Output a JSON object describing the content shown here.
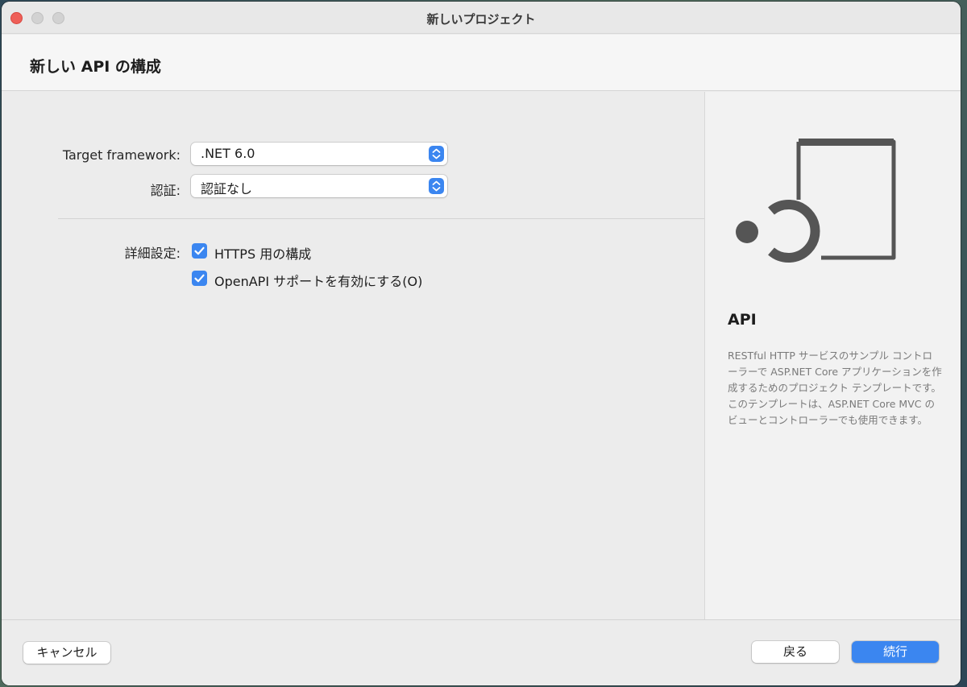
{
  "window": {
    "title": "新しいプロジェクト"
  },
  "header": {
    "title": "新しい API の構成"
  },
  "form": {
    "target_framework": {
      "label": "Target framework:",
      "value": ".NET 6.0"
    },
    "auth": {
      "label": "認証:",
      "value": "認証なし"
    },
    "advanced": {
      "label": "詳細設定:",
      "options": [
        {
          "label": "HTTPS 用の構成",
          "checked": true
        },
        {
          "label": "OpenAPI サポートを有効にする(O)",
          "checked": true
        }
      ]
    }
  },
  "side": {
    "icon": "api-template-icon",
    "title": "API",
    "description": "RESTful HTTP サービスのサンプル コントローラーで ASP.NET Core アプリケーションを作成するためのプロジェクト テンプレートです。このテンプレートは、ASP.NET Core MVC のビューとコントローラーでも使用できます。"
  },
  "footer": {
    "cancel_label": "キャンセル",
    "back_label": "戻る",
    "continue_label": "続行"
  },
  "colors": {
    "accent": "#3b86f0",
    "close": "#ee5f58"
  }
}
